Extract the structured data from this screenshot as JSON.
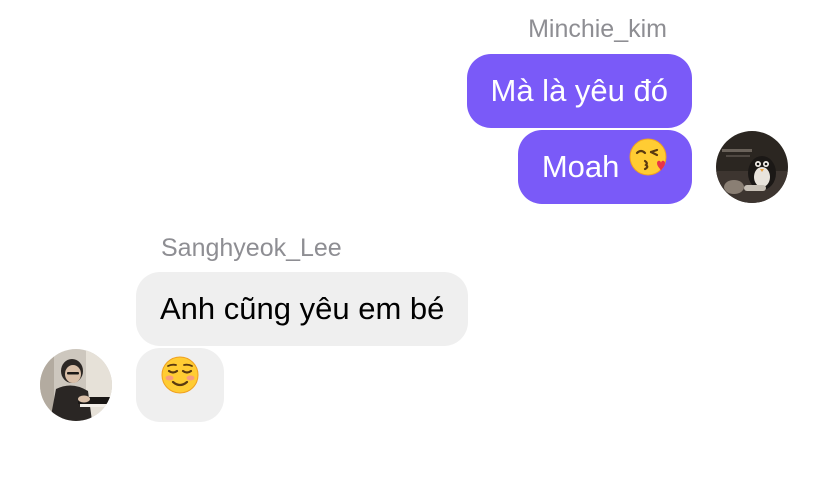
{
  "chat": {
    "outgoing": {
      "sender": "Minchie_kim",
      "messages": [
        {
          "text": "Mà là yêu đó",
          "emoji": ""
        },
        {
          "text": "Moah",
          "emoji": "kissing-face-with-heart-emoji"
        }
      ],
      "avatar": "user-avatar-photo"
    },
    "incoming": {
      "sender": "Sanghyeok_Lee",
      "messages": [
        {
          "text": "Anh cũng yêu em bé",
          "emoji": ""
        },
        {
          "text": "",
          "emoji": "smiling-face-emoji"
        }
      ],
      "avatar": "contact-avatar-photo"
    }
  },
  "colors": {
    "outgoing_bubble": "#7a5af8",
    "incoming_bubble": "#efefef",
    "sender_name": "#8e8e93"
  }
}
